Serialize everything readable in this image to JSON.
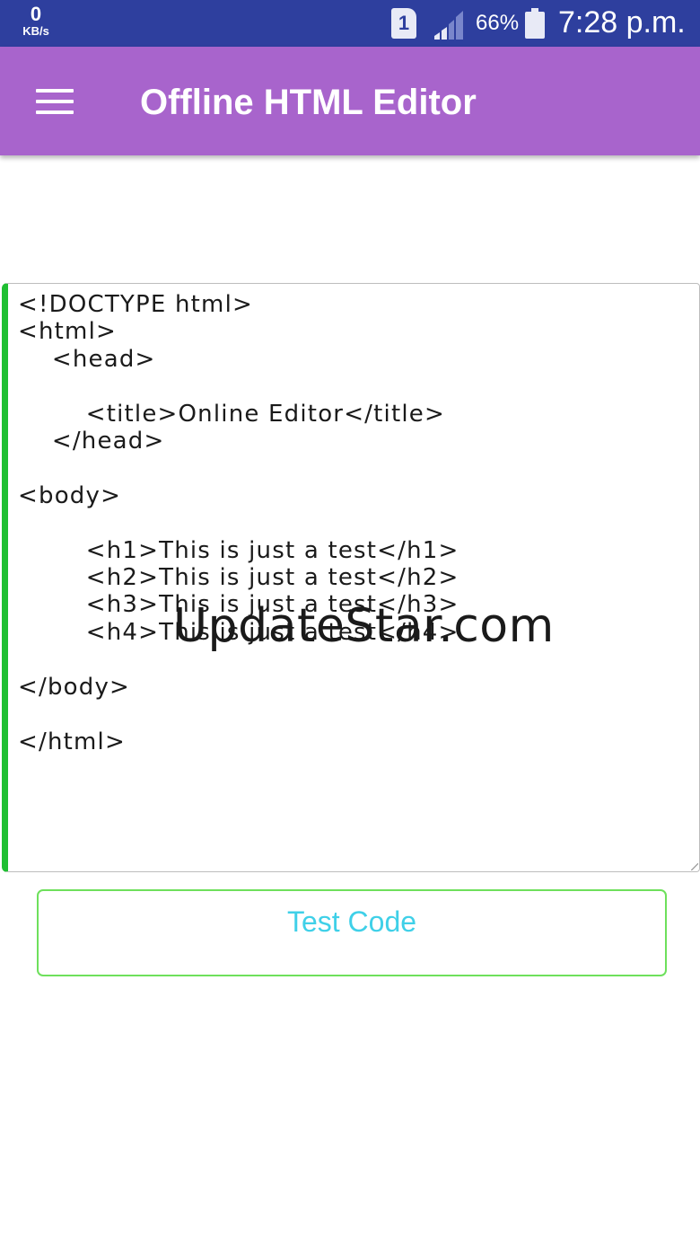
{
  "status_bar": {
    "net_speed_value": "0",
    "net_speed_unit": "KB/s",
    "sim_slot": "1",
    "battery_percent": "66%",
    "time": "7:28 p.m.",
    "background_color": "#2e3f9e"
  },
  "app_bar": {
    "menu_icon": "hamburger-menu-icon",
    "title": "Offline HTML Editor",
    "background_color": "#a864cc"
  },
  "editor": {
    "accent_color": "#1fbf32",
    "lines": [
      "<!DOCTYPE html>",
      "<html>",
      "    <head>",
      "",
      "        <title>Online Editor</title>",
      "    </head>",
      "",
      "<body>",
      "",
      "        <h1>This is just a test</h1>",
      "        <h2>This is just a test</h2>",
      "        <h3>This is just a test</h3>",
      "        <h4>This is just a test</h4>",
      "",
      "</body>",
      "",
      "</html>"
    ]
  },
  "watermark": "UpdateStar.com",
  "test_button": {
    "label": "Test Code",
    "text_color": "#3fd0e8",
    "border_color": "#6ee05c"
  }
}
